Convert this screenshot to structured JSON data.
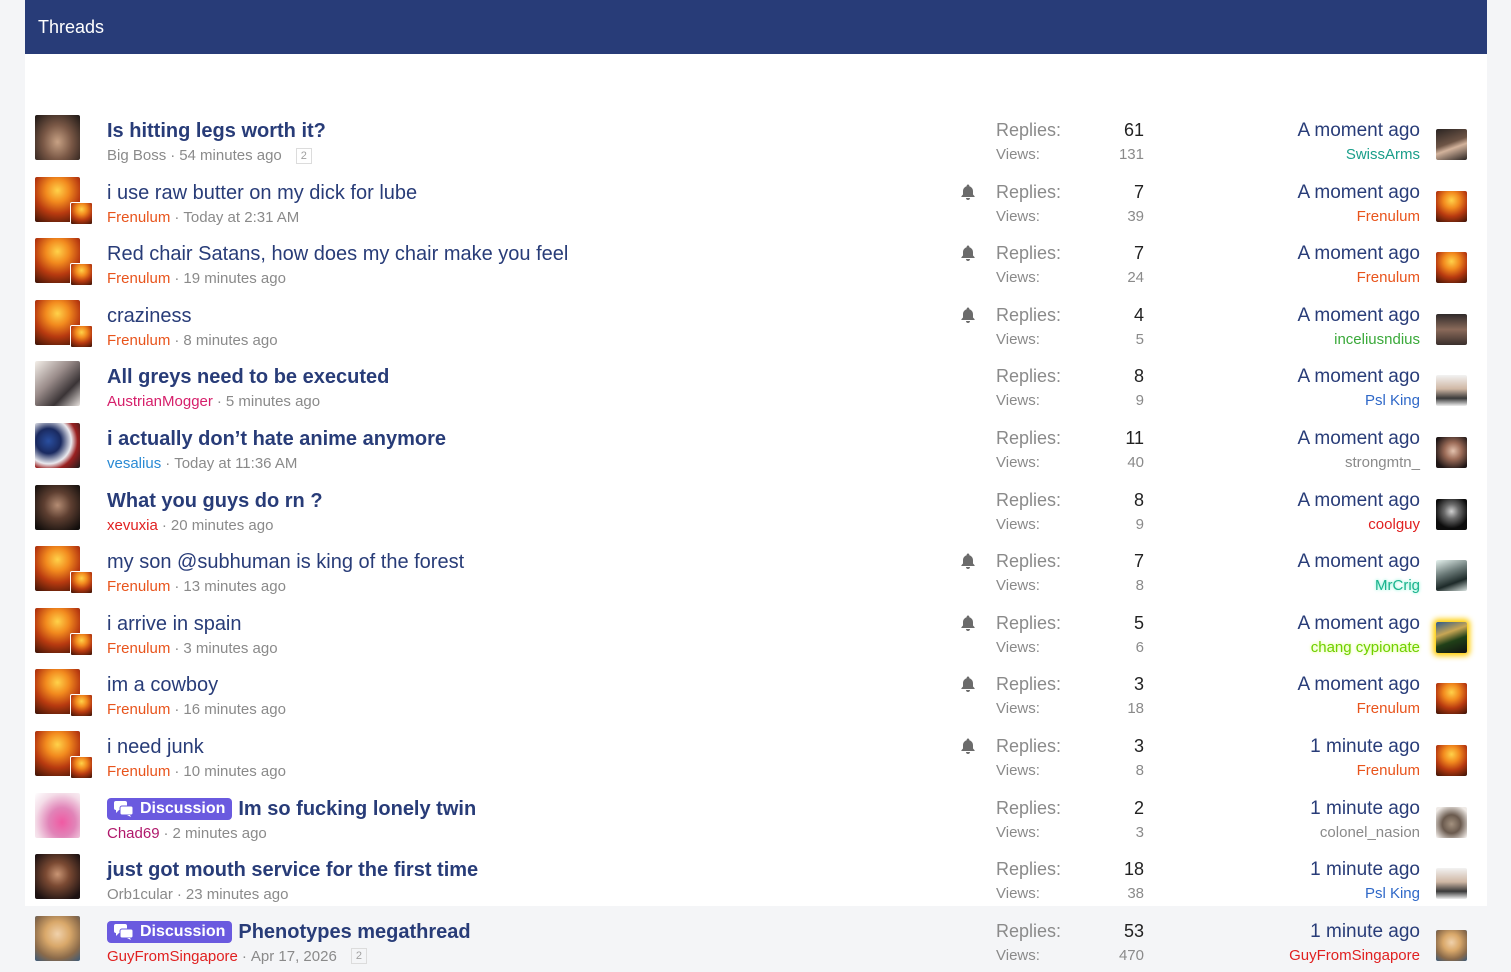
{
  "header": {
    "title": "Threads"
  },
  "labels": {
    "replies": "Replies:",
    "views": "Views:",
    "separator": "·"
  },
  "colors": {
    "header_bg": "#283c78",
    "title": "#283c78",
    "prefix_bg": "#6a5adf",
    "frenulum": "#e8541c",
    "red_user": "#e02020",
    "teal_user": "#1a9e8a",
    "green_user": "#3aa93a",
    "blue_user": "#2f68c8",
    "pink_user": "#d6206b",
    "purple_user": "#b0186b",
    "gray_user": "#8a8a8a"
  },
  "threads": [
    {
      "title": "Is hitting legs worth it?",
      "bold": true,
      "prefix": "",
      "author": "Big Boss",
      "author_color": "#8a8a8a",
      "time": "54 minutes ago",
      "pages": "2",
      "watched": false,
      "replies": "61",
      "views": "131",
      "last_time": "A moment ago",
      "last_user": "SwissArms",
      "last_user_color": "#1a9e8a",
      "avatar": "photo-dark",
      "sub_avatar": false,
      "last_avatar": "photo-man"
    },
    {
      "title": "i use raw butter on my dick for lube",
      "bold": false,
      "prefix": "",
      "author": "Frenulum",
      "author_color": "#e8541c",
      "time": "Today at 2:31 AM",
      "pages": "",
      "watched": true,
      "replies": "7",
      "views": "39",
      "last_time": "A moment ago",
      "last_user": "Frenulum",
      "last_user_color": "#e8541c",
      "avatar": "fire",
      "sub_avatar": true,
      "last_avatar": "fire"
    },
    {
      "title": "Red chair Satans, how does my chair make you feel",
      "bold": false,
      "prefix": "",
      "author": "Frenulum",
      "author_color": "#e8541c",
      "time": "19 minutes ago",
      "pages": "",
      "watched": true,
      "replies": "7",
      "views": "24",
      "last_time": "A moment ago",
      "last_user": "Frenulum",
      "last_user_color": "#e8541c",
      "avatar": "fire",
      "sub_avatar": true,
      "last_avatar": "fire"
    },
    {
      "title": "craziness",
      "bold": false,
      "prefix": "",
      "author": "Frenulum",
      "author_color": "#e8541c",
      "time": "8 minutes ago",
      "pages": "",
      "watched": true,
      "replies": "4",
      "views": "5",
      "last_time": "A moment ago",
      "last_user": "inceliusndius",
      "last_user_color": "#3aa93a",
      "avatar": "fire",
      "sub_avatar": true,
      "last_avatar": "photo-man2"
    },
    {
      "title": "All greys need to be executed",
      "bold": true,
      "prefix": "",
      "author": "AustrianMogger",
      "author_color": "#d6206b",
      "time": "5 minutes ago",
      "pages": "",
      "watched": false,
      "replies": "8",
      "views": "9",
      "last_time": "A moment ago",
      "last_user": "Psl King",
      "last_user_color": "#2f68c8",
      "avatar": "anime",
      "sub_avatar": false,
      "last_avatar": "photo-light"
    },
    {
      "title": "i actually don’t hate anime anymore",
      "bold": true,
      "prefix": "",
      "author": "vesalius",
      "author_color": "#2a8ad4",
      "time": "Today at 11:36 AM",
      "pages": "",
      "watched": false,
      "replies": "11",
      "views": "40",
      "last_time": "A moment ago",
      "last_user": "strongmtn_",
      "last_user_color": "#8a8a8a",
      "avatar": "group",
      "sub_avatar": false,
      "last_avatar": "photo-woman"
    },
    {
      "title": "What you guys do rn ?",
      "bold": true,
      "prefix": "",
      "author": "xevuxia",
      "author_color": "#e02020",
      "time": "20 minutes ago",
      "pages": "",
      "watched": false,
      "replies": "8",
      "views": "9",
      "last_time": "A moment ago",
      "last_user": "coolguy",
      "last_user_color": "#e02020",
      "avatar": "photo-dark2",
      "sub_avatar": false,
      "last_avatar": "photo-bw"
    },
    {
      "title": "my son @subhuman is king of the forest",
      "bold": false,
      "prefix": "",
      "author": "Frenulum",
      "author_color": "#e8541c",
      "time": "13 minutes ago",
      "pages": "",
      "watched": true,
      "replies": "7",
      "views": "8",
      "last_time": "A moment ago",
      "last_user": "MrCrig",
      "last_user_color": "#1bb38d",
      "avatar": "fire",
      "sub_avatar": true,
      "last_avatar": "photo-green"
    },
    {
      "title": "i arrive in spain",
      "bold": false,
      "prefix": "",
      "author": "Frenulum",
      "author_color": "#e8541c",
      "time": "3 minutes ago",
      "pages": "",
      "watched": true,
      "replies": "5",
      "views": "6",
      "last_time": "A moment ago",
      "last_user": "chang cypionate",
      "last_user_color": "#6fd000",
      "avatar": "fire",
      "sub_avatar": true,
      "last_avatar": "photo-glow"
    },
    {
      "title": "im a cowboy",
      "bold": false,
      "prefix": "",
      "author": "Frenulum",
      "author_color": "#e8541c",
      "time": "16 minutes ago",
      "pages": "",
      "watched": true,
      "replies": "3",
      "views": "18",
      "last_time": "A moment ago",
      "last_user": "Frenulum",
      "last_user_color": "#e8541c",
      "avatar": "fire",
      "sub_avatar": true,
      "last_avatar": "fire"
    },
    {
      "title": "i need junk",
      "bold": false,
      "prefix": "",
      "author": "Frenulum",
      "author_color": "#e8541c",
      "time": "10 minutes ago",
      "pages": "",
      "watched": true,
      "replies": "3",
      "views": "8",
      "last_time": "1 minute ago",
      "last_user": "Frenulum",
      "last_user_color": "#e8541c",
      "avatar": "fire",
      "sub_avatar": true,
      "last_avatar": "fire"
    },
    {
      "title": "Im so fucking lonely twin",
      "bold": true,
      "prefix": "Discussion",
      "author": "Chad69",
      "author_color": "#b0186b",
      "time": "2 minutes ago",
      "pages": "",
      "watched": false,
      "replies": "2",
      "views": "3",
      "last_time": "1 minute ago",
      "last_user": "colonel_nasion",
      "last_user_color": "#8a8a8a",
      "avatar": "pink",
      "sub_avatar": false,
      "last_avatar": "photo-muscle"
    },
    {
      "title": "just got mouth service for the first time",
      "bold": true,
      "prefix": "",
      "author": "Orb1cular",
      "author_color": "#8a8a8a",
      "time": "23 minutes ago",
      "pages": "",
      "watched": false,
      "replies": "18",
      "views": "38",
      "last_time": "1 minute ago",
      "last_user": "Psl King",
      "last_user_color": "#2f68c8",
      "avatar": "photo-crowd",
      "sub_avatar": false,
      "last_avatar": "photo-light"
    },
    {
      "title": "Phenotypes megathread",
      "bold": true,
      "prefix": "Discussion",
      "author": "GuyFromSingapore",
      "author_color": "#e02020",
      "time": "Apr 17, 2026",
      "pages": "2",
      "watched": false,
      "replies": "53",
      "views": "470",
      "last_time": "1 minute ago",
      "last_user": "GuyFromSingapore",
      "last_user_color": "#e02020",
      "avatar": "photo-blonde",
      "sub_avatar": false,
      "last_avatar": "photo-blonde"
    }
  ]
}
